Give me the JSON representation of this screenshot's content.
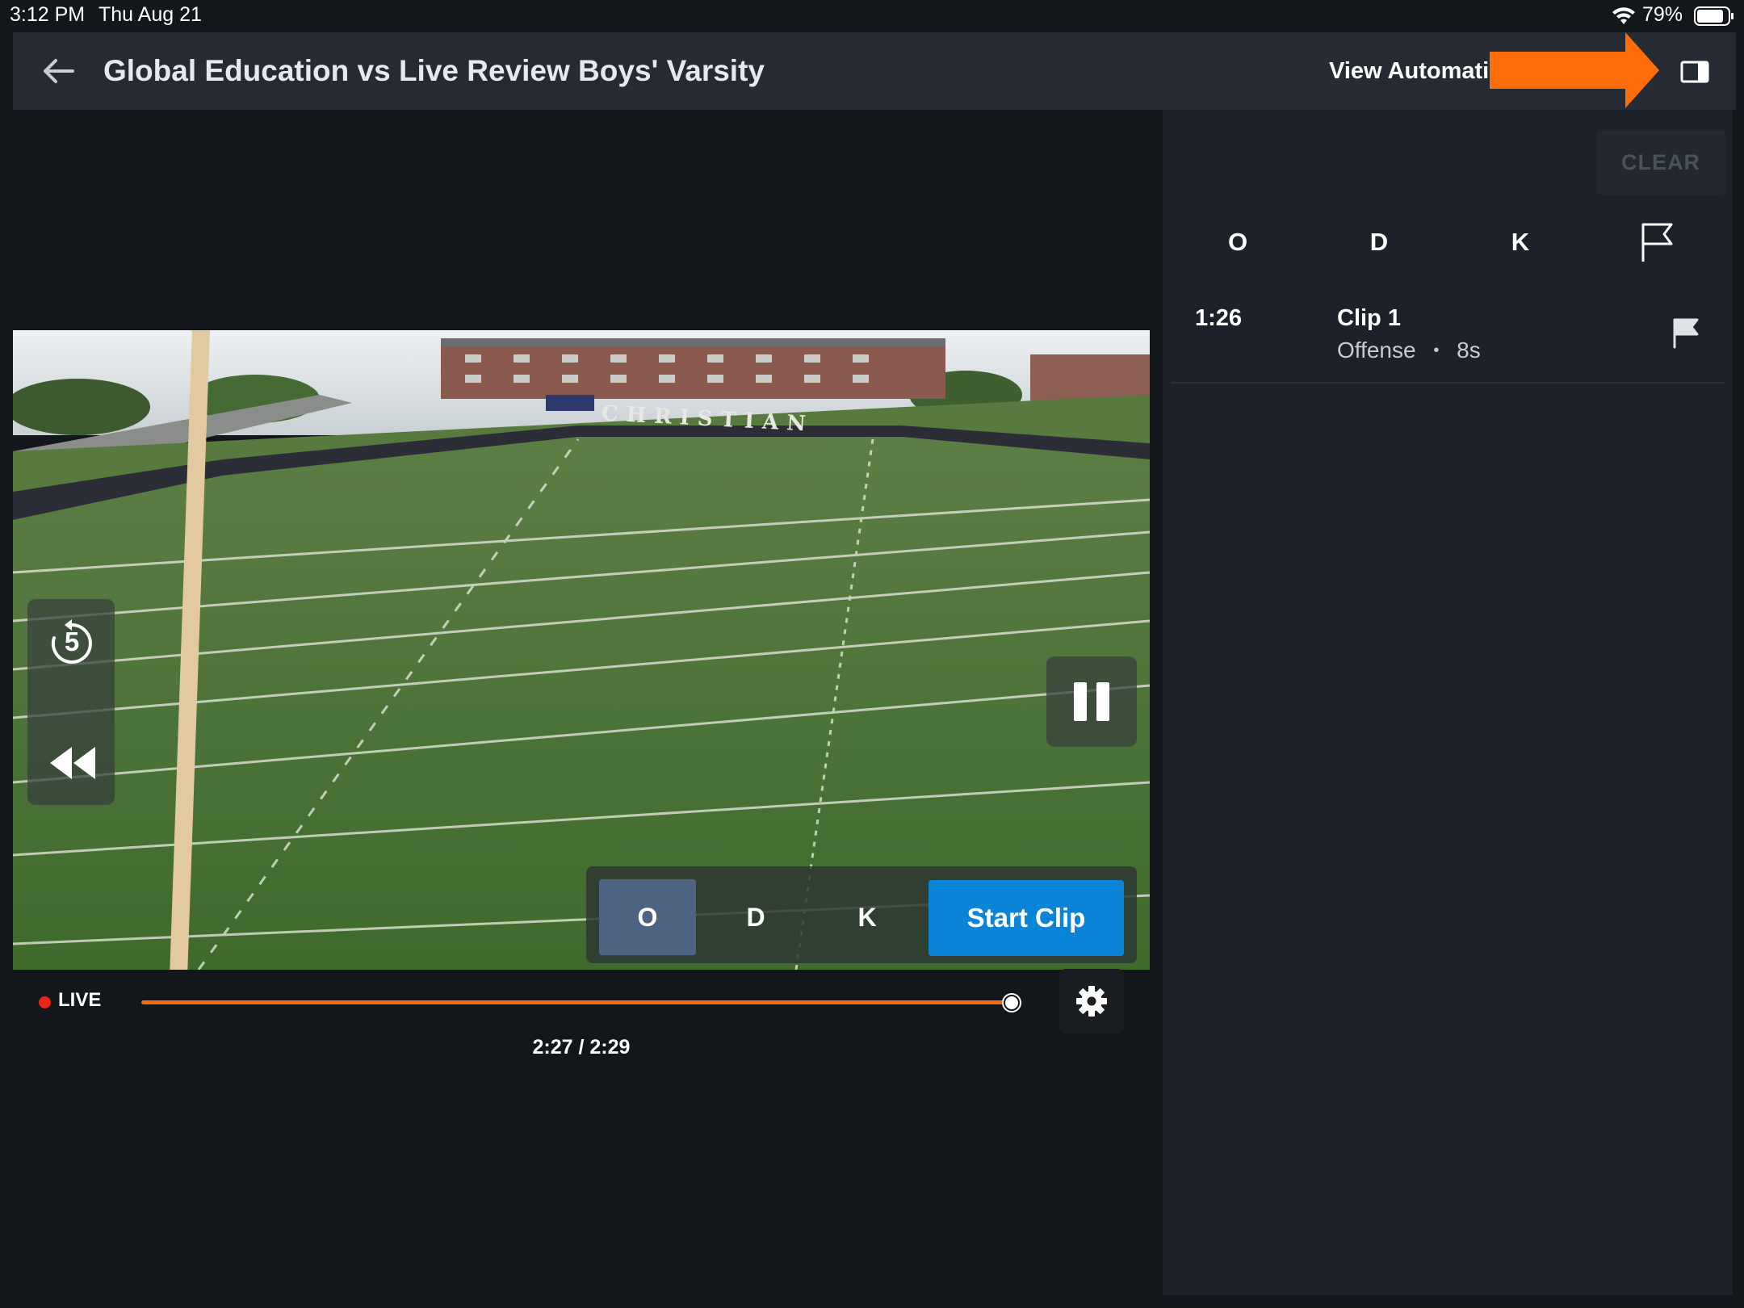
{
  "status_bar": {
    "time": "3:12 PM",
    "date": "Thu Aug 21",
    "battery": "79%",
    "icons": [
      "wifi-icon",
      "battery-icon"
    ]
  },
  "header": {
    "back_icon": "arrow-left-icon",
    "title": "Global Education vs Live Review Boys' Varsity F",
    "view_automatic": "View Automati",
    "panel_toggle_icon": "sidebar-panel-icon"
  },
  "player": {
    "replay_label": "5",
    "replay_icon": "replay-5-icon",
    "rewind_icon": "rewind-icon",
    "pause_icon": "pause-icon",
    "tags": [
      "O",
      "D",
      "K"
    ],
    "active_tag": "O",
    "start_clip": "Start Clip",
    "live_label": "LIVE",
    "progress": 0.987,
    "time_readout": "2:27 / 2:29",
    "settings_icon": "gear-icon",
    "field_sign": "CHRISTIAN",
    "colors": {
      "accent": "#f2690f",
      "primary": "#0a84d6",
      "live": "#e5261c"
    }
  },
  "panel": {
    "clear_label": "CLEAR",
    "filters": [
      "O",
      "D",
      "K"
    ],
    "flag_filter_icon": "flag-outline-icon",
    "clips": [
      {
        "time": "1:26",
        "name": "Clip 1",
        "category": "Offense",
        "separator": "•",
        "duration": "8s",
        "icon": "flag-icon"
      }
    ]
  },
  "annotation": {
    "icon": "arrow-right-icon",
    "color": "#ff6d0a"
  }
}
